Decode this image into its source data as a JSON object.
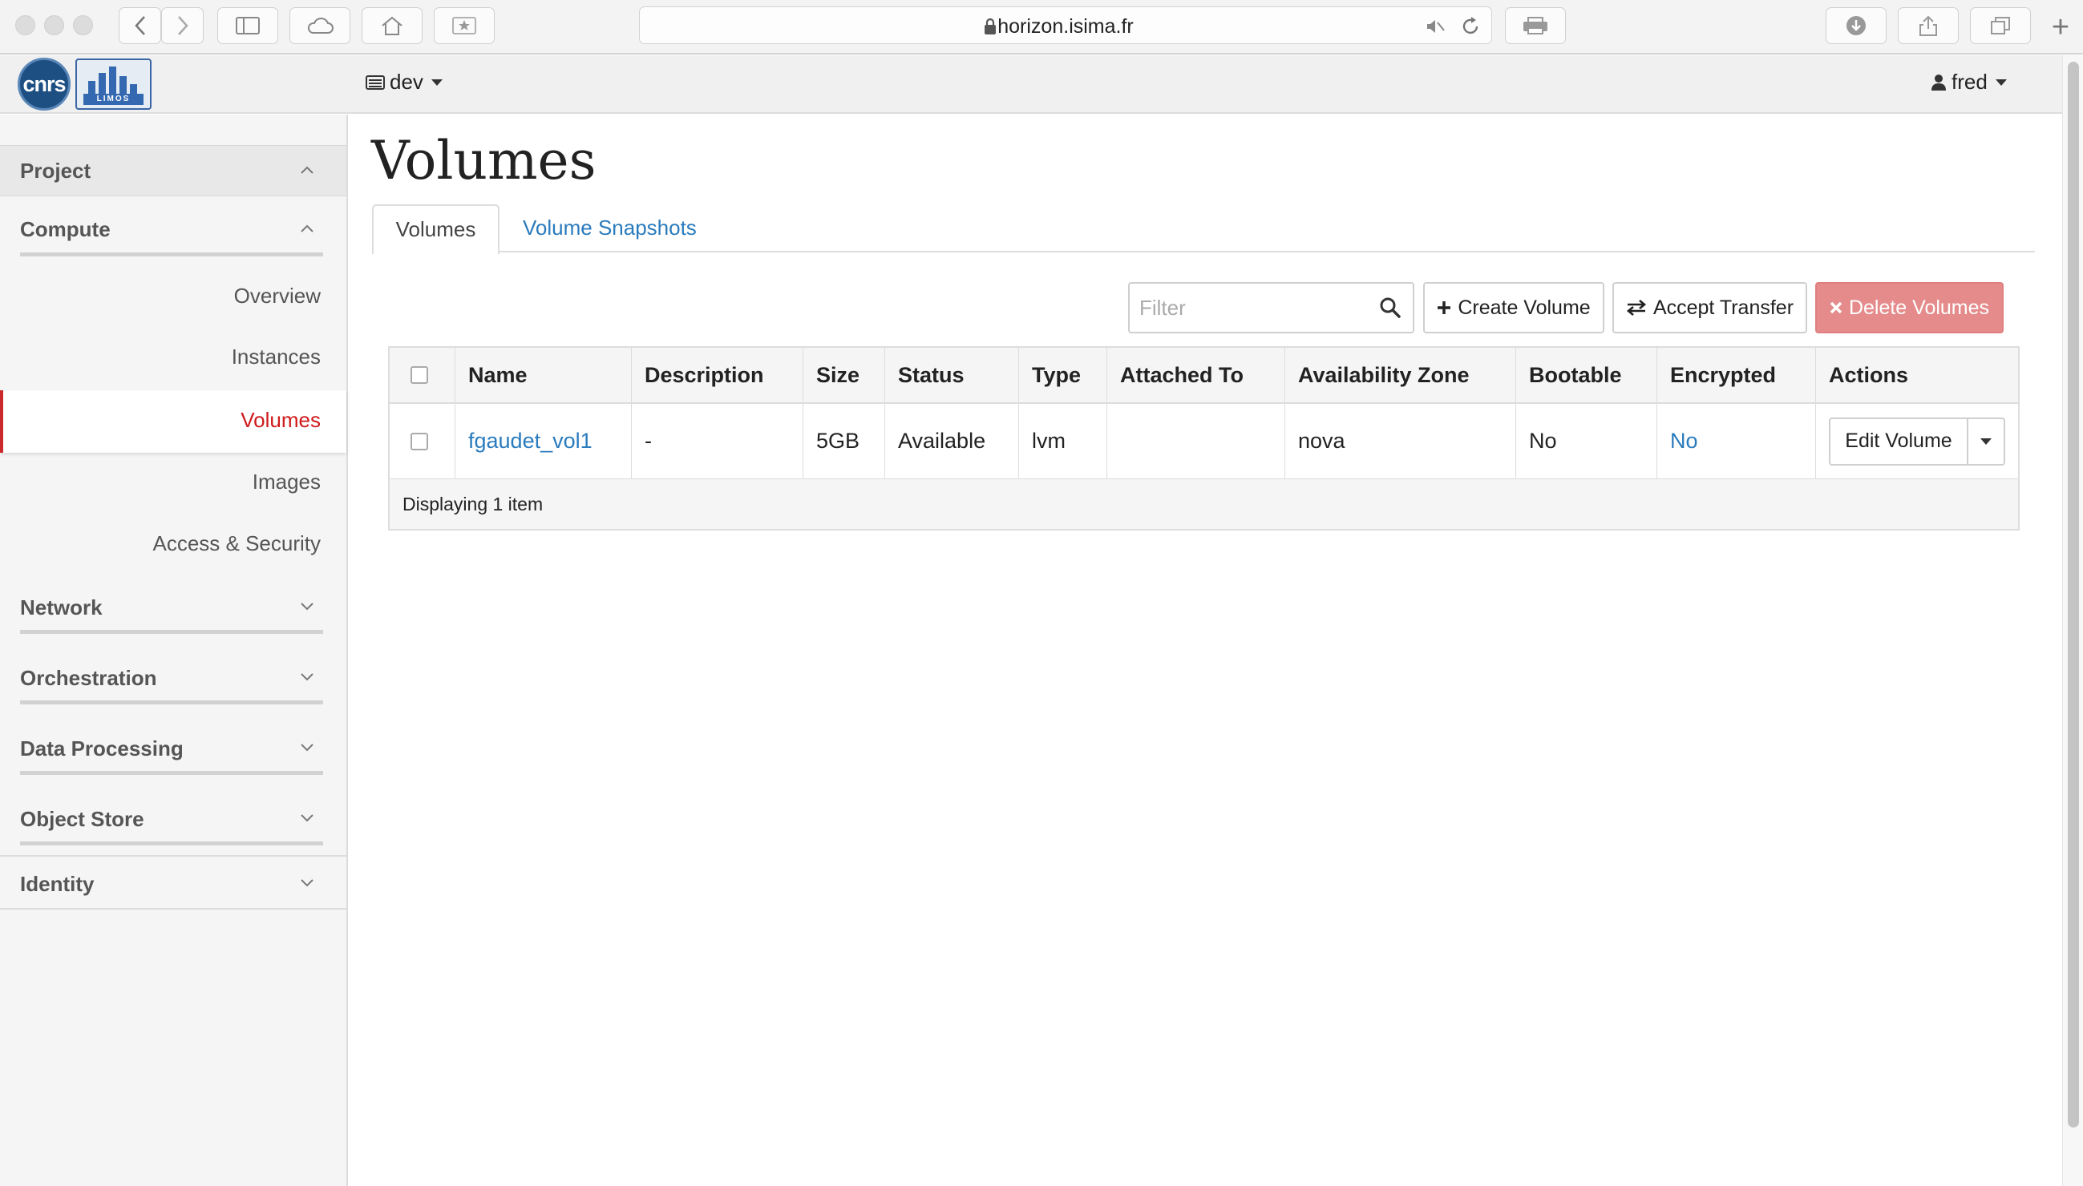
{
  "browser": {
    "url": "horizon.isima.fr"
  },
  "topbar": {
    "logo_primary": "cnrs",
    "logo_secondary": "LIMOS",
    "project": "dev",
    "user": "fred"
  },
  "sidebar": {
    "project_label": "Project",
    "compute_label": "Compute",
    "compute_items": [
      "Overview",
      "Instances",
      "Volumes",
      "Images",
      "Access & Security"
    ],
    "active_item": "Volumes",
    "sections": [
      "Network",
      "Orchestration",
      "Data Processing",
      "Object Store"
    ],
    "identity_label": "Identity"
  },
  "main": {
    "title": "Volumes",
    "tabs": [
      "Volumes",
      "Volume Snapshots"
    ],
    "filter_placeholder": "Filter",
    "actions": {
      "create": "Create Volume",
      "accept": "Accept Transfer",
      "delete": "Delete Volumes"
    },
    "table": {
      "columns": [
        "Name",
        "Description",
        "Size",
        "Status",
        "Type",
        "Attached To",
        "Availability Zone",
        "Bootable",
        "Encrypted",
        "Actions"
      ],
      "rows": [
        {
          "name": "fgaudet_vol1",
          "description": "-",
          "size": "5GB",
          "status": "Available",
          "type": "lvm",
          "attached_to": "",
          "availability_zone": "nova",
          "bootable": "No",
          "encrypted": "No",
          "action": "Edit Volume"
        }
      ],
      "footer": "Displaying 1 item"
    }
  },
  "colors": {
    "link": "#2a7bbd",
    "active_nav": "#cf1b1b",
    "danger_button": "#e58b8b"
  },
  "icons": [
    "lock-icon",
    "mute-icon",
    "reload-icon",
    "search-icon",
    "plus-icon",
    "transfer-icon",
    "times-icon",
    "user-icon",
    "server-icon"
  ]
}
